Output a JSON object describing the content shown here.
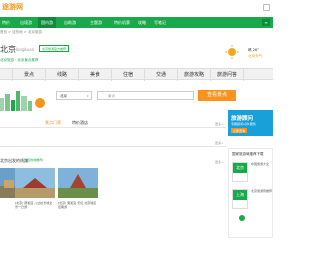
{
  "header": {
    "logo": "途游网",
    "search_hint": "",
    "nav": [
      "特价",
      "出境游",
      "国内游",
      "自助游",
      "主题游",
      "特价机票",
      "攻略",
      "写笔记"
    ]
  },
  "breadcrumb": "首页 > 目的地 > 北京旅游",
  "city": {
    "name": "北京",
    "name_en": "Hongkuan",
    "badge": "北京旅游官方推荐",
    "sub": "北京旅游 · 北京景点推荐"
  },
  "weather": {
    "temp": "晴 26°",
    "label": "北京天气",
    "icon": "sun-icon"
  },
  "tabs": [
    "景点",
    "线路",
    "美食",
    "住宿",
    "交通",
    "旅游攻略",
    "旅游问答"
  ],
  "search": {
    "city_value": "北京",
    "placeholder": "景点",
    "button": "查看景点"
  },
  "promo": {
    "title": "旅游顾问",
    "subtitle": "专属顾问1对1服务",
    "button": "立即咨询"
  },
  "sections": {
    "top_tabs": [
      "景点门票",
      "特价酒店"
    ],
    "more1": "更多>",
    "routes_title": "北京出发的线路",
    "routes_sub": "[目的地推荐]",
    "more2": "更多>",
    "more3": "更多>",
    "side_title": "国家旅游局推荐下载",
    "side_items": [
      {
        "tag": "北京",
        "text": "中国旅游大全"
      },
      {
        "tag": "上海",
        "text": "北京旅游局推荐"
      }
    ],
    "cards": [
      {
        "cap": "[北京] 北京天安门广场故宫一日游"
      },
      {
        "cap": "[北京] 颐和园 八达岭长城全景一日游"
      },
      {
        "cap": "[北京] 雍和宫 天坛 北京城区经典游"
      }
    ]
  },
  "colors": {
    "brand_green": "#19a84a",
    "accent_orange": "#f7931e",
    "tab_bg": "#f1f1f1"
  }
}
